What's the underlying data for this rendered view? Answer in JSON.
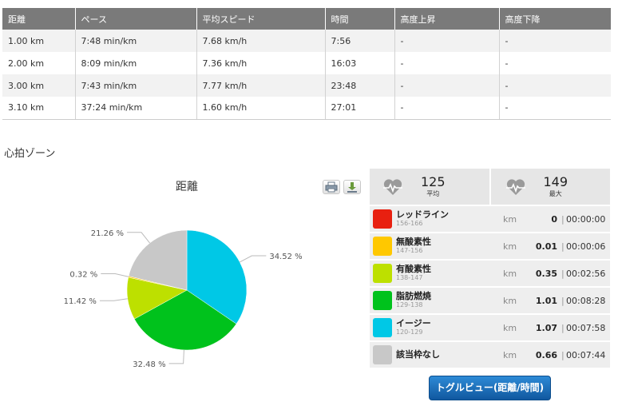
{
  "splits": {
    "headers": [
      "距離",
      "ペース",
      "平均スピード",
      "時間",
      "高度上昇",
      "高度下降"
    ],
    "rows": [
      [
        "1.00 km",
        "7:48 min/km",
        "7.68 km/h",
        "7:56",
        "-",
        "-"
      ],
      [
        "2.00 km",
        "8:09 min/km",
        "7.36 km/h",
        "16:03",
        "-",
        "-"
      ],
      [
        "3.00 km",
        "7:43 min/km",
        "7.77 km/h",
        "23:48",
        "-",
        "-"
      ],
      [
        "3.10 km",
        "37:24 min/km",
        "1.60 km/h",
        "27:01",
        "-",
        "-"
      ]
    ]
  },
  "heart_zone_section": {
    "title": "心拍ゾーン"
  },
  "chart_data": {
    "type": "pie",
    "title": "距離",
    "slices": [
      {
        "label": "34.52 %",
        "value": 34.52,
        "color": "#00c8e6"
      },
      {
        "label": "32.48 %",
        "value": 32.48,
        "color": "#00c21c"
      },
      {
        "label": "11.42 %",
        "value": 11.42,
        "color": "#bde000"
      },
      {
        "label": "0.32 %",
        "value": 0.32,
        "color": "#ffc800"
      },
      {
        "label": "",
        "value": 0.0,
        "color": "#e82010"
      },
      {
        "label": "21.26 %",
        "value": 21.26,
        "color": "#c8c8c8"
      }
    ]
  },
  "chart_tools": {
    "print_icon": "print-icon",
    "export_icon": "download-icon"
  },
  "stats": {
    "avg": {
      "value": "125",
      "label": "平均",
      "icon": "heart-pulse-icon"
    },
    "max": {
      "value": "149",
      "label": "最大",
      "icon": "heart-pulse-icon"
    },
    "zones": [
      {
        "name": "レッドライン",
        "range": "156-166",
        "color": "#e82010",
        "unit": "km",
        "distance": "0",
        "time": "00:00:00"
      },
      {
        "name": "無酸素性",
        "range": "147-156",
        "color": "#ffc800",
        "unit": "km",
        "distance": "0.01",
        "time": "00:00:06"
      },
      {
        "name": "有酸素性",
        "range": "138-147",
        "color": "#bde000",
        "unit": "km",
        "distance": "0.35",
        "time": "00:02:56"
      },
      {
        "name": "脂肪燃焼",
        "range": "129-138",
        "color": "#00c21c",
        "unit": "km",
        "distance": "1.01",
        "time": "00:08:28"
      },
      {
        "name": "イージー",
        "range": "120-129",
        "color": "#00c8e6",
        "unit": "km",
        "distance": "1.07",
        "time": "00:07:58"
      },
      {
        "name": "該当枠なし",
        "range": "",
        "color": "#c8c8c8",
        "unit": "km",
        "distance": "0.66",
        "time": "00:07:44"
      }
    ]
  },
  "toggle_button": {
    "label": "トグルビュー(距離/時間)"
  }
}
